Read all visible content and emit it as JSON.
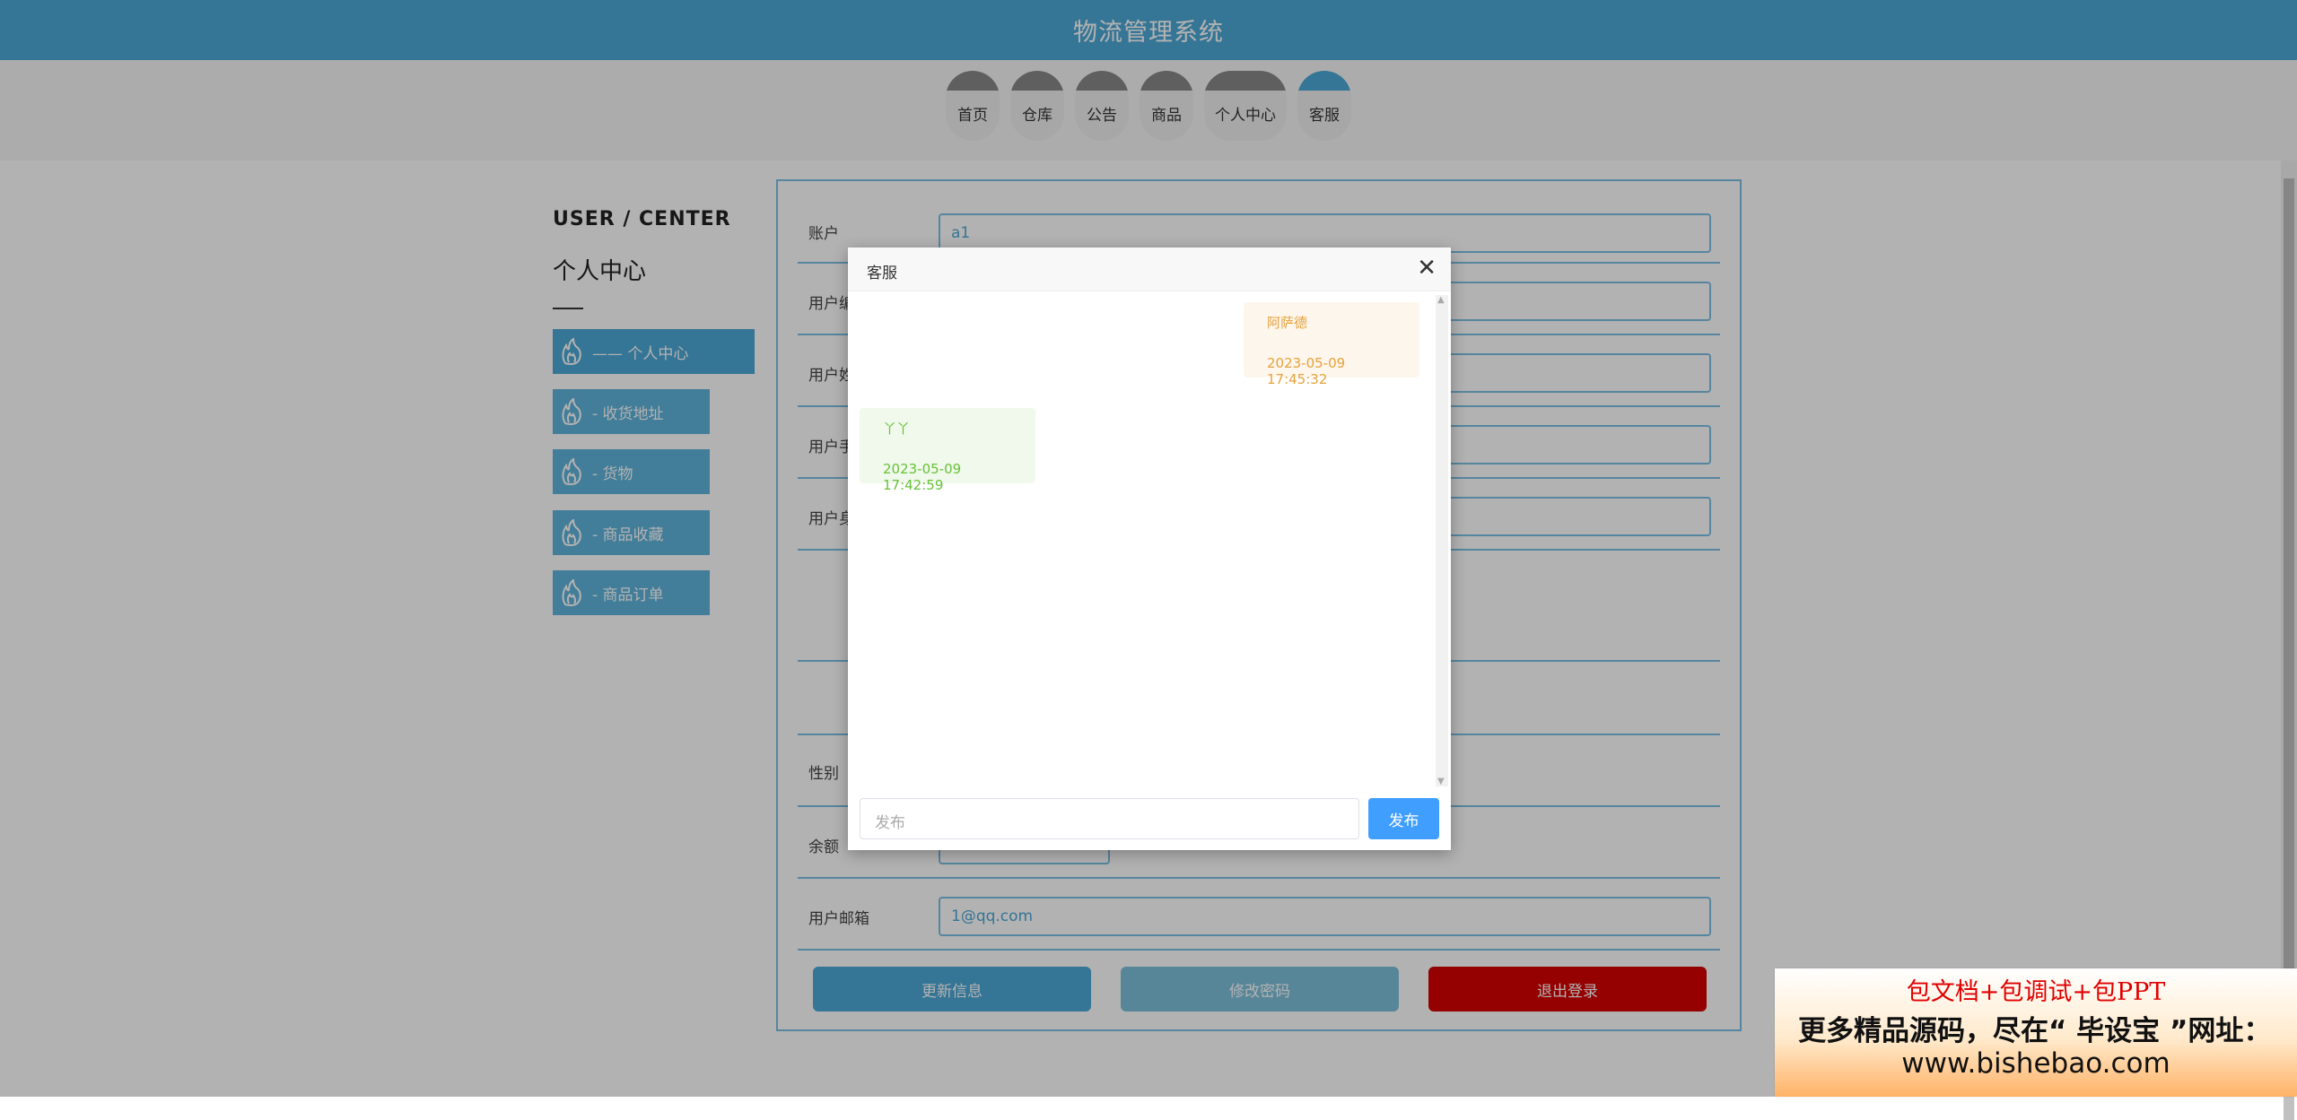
{
  "header": {
    "title": "物流管理系统"
  },
  "nav": [
    {
      "label": "首页",
      "active": false
    },
    {
      "label": "仓库",
      "active": false
    },
    {
      "label": "公告",
      "active": false
    },
    {
      "label": "商品",
      "active": false
    },
    {
      "label": "个人中心",
      "active": false
    },
    {
      "label": "客服",
      "active": true
    }
  ],
  "left_menu": {
    "heading": "USER / CENTER",
    "title": "个人中心",
    "items": [
      {
        "label": "——  个人中心",
        "icon": "flame-hand-icon"
      },
      {
        "label": "-  收货地址",
        "icon": "flame-hand-icon"
      },
      {
        "label": "-  货物",
        "icon": "flame-hand-icon"
      },
      {
        "label": "-  商品收藏",
        "icon": "flame-hand-icon"
      },
      {
        "label": "-  商品订单",
        "icon": "flame-hand-icon"
      }
    ]
  },
  "form": {
    "account_label": "账户",
    "account_value": "a1",
    "username_label": "用户编",
    "name_label": "用户姓",
    "phone_label": "用户手",
    "id_label": "用户身",
    "gender_label": "性别",
    "balance_label": "余额",
    "email_label": "用户邮箱",
    "email_value": "1@qq.com"
  },
  "buttons": {
    "update": "更新信息",
    "change_password": "修改密码",
    "logout": "退出登录"
  },
  "dialog": {
    "title": "客服",
    "close_icon": "close-icon",
    "messages": [
      {
        "side": "right",
        "text": "阿萨德",
        "time": "2023-05-09 17:45:32"
      },
      {
        "side": "left",
        "text": "丫丫",
        "time": "2023-05-09 17:42:59"
      }
    ],
    "input_placeholder": "发布",
    "send_label": "发布"
  },
  "ad": {
    "line1": "包文档+包调试+包PPT",
    "line2": "更多精品源码，尽在“ 毕设宝 ”网址：",
    "line3": "www.bishebao.com"
  },
  "colors": {
    "primary": "#4ca8d6",
    "send_button": "#409eff",
    "logout_button": "#d60000",
    "right_bubble_bg": "#fdf6ec",
    "left_bubble_bg": "#f0f9eb"
  }
}
